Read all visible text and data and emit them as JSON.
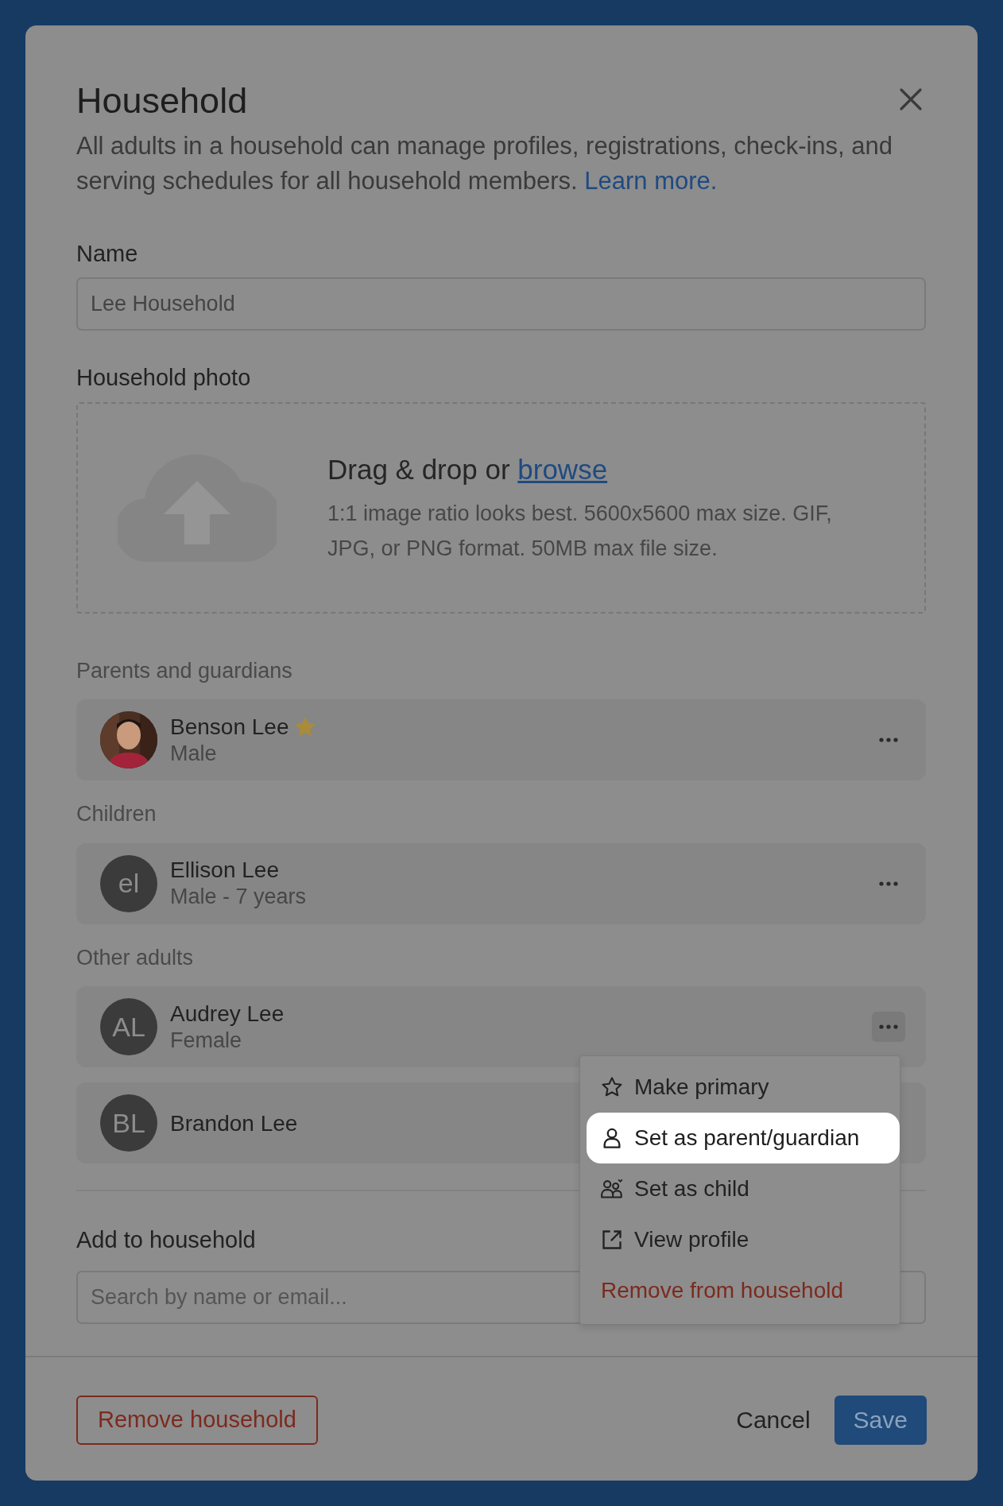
{
  "dialog": {
    "title": "Household",
    "description": "All adults in a household can manage profiles, registrations, check-ins, and serving schedules for all household members.",
    "learn_more": "Learn more."
  },
  "name_field": {
    "label": "Name",
    "value": "Lee Household"
  },
  "photo": {
    "label": "Household photo",
    "prompt": "Drag & drop or",
    "browse": "browse",
    "hint": "1:1 image ratio looks best. 5600x5600 max size. GIF, JPG, or PNG format. 50MB max file size."
  },
  "groups": [
    {
      "heading": "Parents and guardians",
      "members": [
        {
          "name": "Benson Lee",
          "detail": "Male",
          "primary": true,
          "menu_open": false,
          "menu_shown": true
        }
      ]
    },
    {
      "heading": "Children",
      "members": [
        {
          "name": "Ellison Lee",
          "detail": "Male - 7 years",
          "avatar": {
            "kind": "initials",
            "text": "el"
          },
          "primary": false,
          "menu_open": false,
          "menu_shown": true
        }
      ]
    },
    {
      "heading": "Other adults",
      "members": [
        {
          "name": "Audrey Lee",
          "detail": "Female",
          "avatar": {
            "kind": "initials",
            "text": "AL"
          },
          "primary": false,
          "menu_open": true,
          "menu_shown": true
        },
        {
          "name": "Brandon Lee",
          "avatar": {
            "kind": "initials",
            "text": "BL"
          },
          "primary": false,
          "menu_open": false,
          "menu_shown": false
        }
      ]
    }
  ],
  "member_menu": {
    "items": [
      {
        "label": "Make primary",
        "kind": "action",
        "selected": false
      },
      {
        "label": "Set as parent/guardian",
        "kind": "action",
        "selected": true
      },
      {
        "label": "Set as child",
        "kind": "action",
        "selected": false
      },
      {
        "label": "View profile",
        "kind": "action",
        "selected": false
      },
      {
        "label": "Remove from household",
        "kind": "danger",
        "selected": false
      }
    ]
  },
  "add_member": {
    "label": "Add to household",
    "placeholder": "Search by name or email..."
  },
  "footer": {
    "remove": "Remove household",
    "cancel": "Cancel",
    "save": "Save"
  }
}
